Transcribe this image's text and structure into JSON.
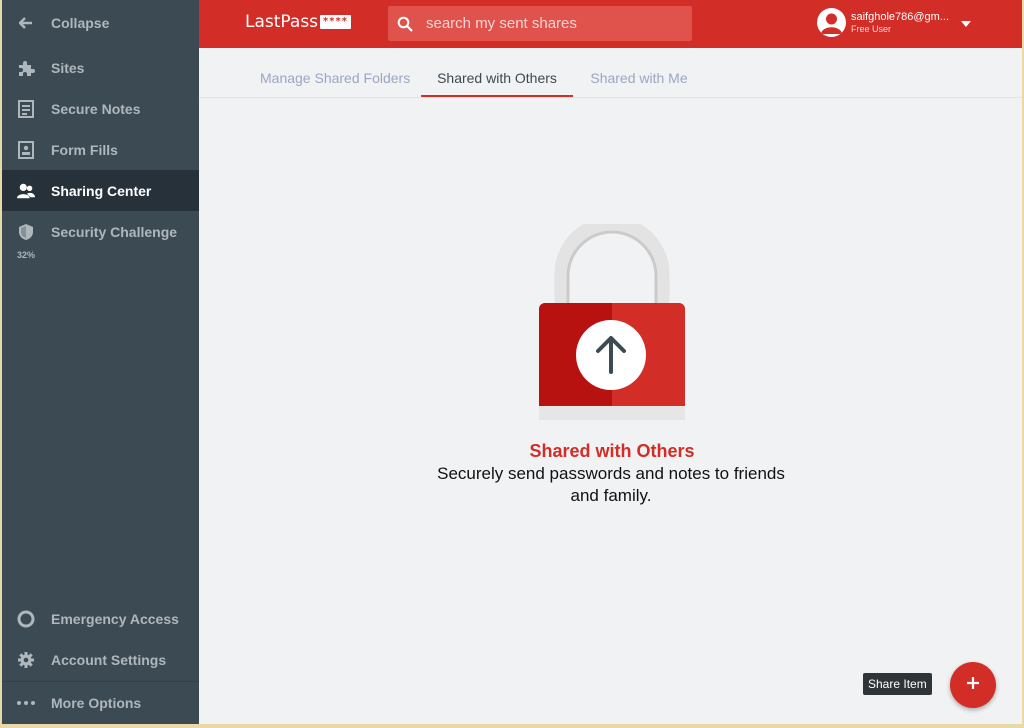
{
  "sidebar": {
    "collapse": "Collapse",
    "items": [
      {
        "label": "Sites",
        "icon": "puzzle-icon"
      },
      {
        "label": "Secure Notes",
        "icon": "note-icon"
      },
      {
        "label": "Form Fills",
        "icon": "id-card-icon"
      },
      {
        "label": "Sharing Center",
        "icon": "people-icon"
      },
      {
        "label": "Security Challenge",
        "icon": "shield-icon"
      }
    ],
    "security_score": "32%",
    "bottom_items": [
      {
        "label": "Emergency Access",
        "icon": "lifebuoy-icon"
      },
      {
        "label": "Account Settings",
        "icon": "gear-icon"
      },
      {
        "label": "More Options",
        "icon": "more-dots-icon"
      }
    ]
  },
  "header": {
    "logo_text": "LastPass",
    "logo_stars": "****",
    "search_placeholder": "search my sent shares",
    "user_email": "saifghole786@gm...",
    "user_plan": "Free User"
  },
  "tabs": [
    {
      "label": "Manage Shared Folders",
      "active": false
    },
    {
      "label": "Shared with Others",
      "active": true
    },
    {
      "label": "Shared with Me",
      "active": false
    }
  ],
  "empty_state": {
    "title": "Shared with Others",
    "description": "Securely send passwords and notes to friends and family."
  },
  "fab": {
    "tooltip": "Share Item",
    "icon": "plus-icon"
  },
  "colors": {
    "brand_red": "#d32d27",
    "sidebar_bg": "#3c4a53",
    "sidebar_active": "#26313a",
    "content_bg": "#f1f2f4"
  }
}
